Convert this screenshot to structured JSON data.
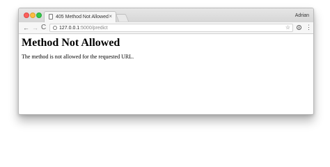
{
  "tab": {
    "title": "405 Method Not Allowed",
    "close": "×"
  },
  "profile": {
    "name": "Adrian"
  },
  "toolbar": {
    "back": "←",
    "forward": "→",
    "reload": "C",
    "menu": "⋮",
    "star": "☆"
  },
  "address": {
    "host": "127.0.0.1",
    "path": ":5000/predict"
  },
  "page": {
    "heading": "Method Not Allowed",
    "message": "The method is not allowed for the requested URL."
  }
}
